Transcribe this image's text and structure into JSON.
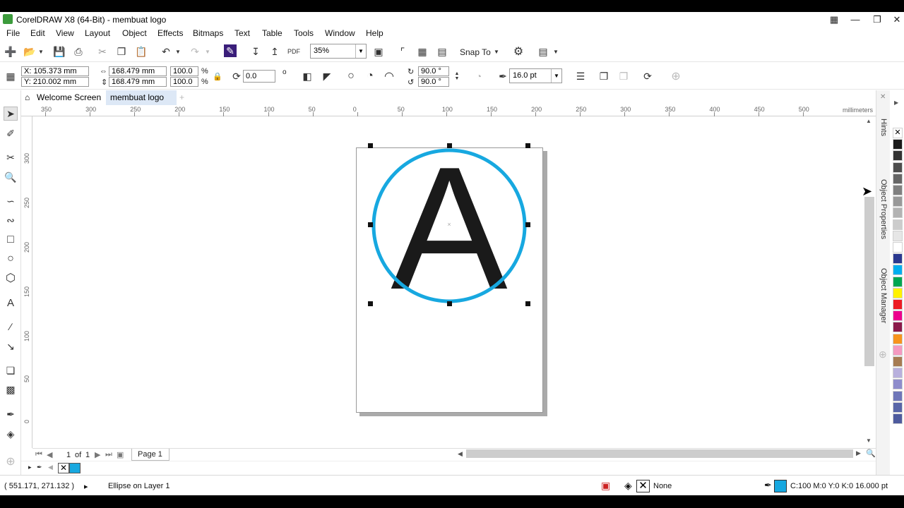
{
  "window": {
    "title": "CorelDRAW X8 (64-Bit) - membuat logo"
  },
  "menu": [
    "File",
    "Edit",
    "View",
    "Layout",
    "Object",
    "Effects",
    "Bitmaps",
    "Text",
    "Table",
    "Tools",
    "Window",
    "Help"
  ],
  "toolbar": {
    "zoom": "35%",
    "snap_label": "Snap To"
  },
  "property_bar": {
    "x": "X: 105.373 mm",
    "y": "Y: 210.002 mm",
    "width": "168.479 mm",
    "height": "168.479 mm",
    "scale_x": "100.0",
    "scale_y": "100.0",
    "pct": "%",
    "rotation": "0.0",
    "deg": "o",
    "angle_start": "90.0 °",
    "angle_end": "90.0 °",
    "outline": "16.0 pt"
  },
  "tabs": {
    "welcome": "Welcome Screen",
    "doc": "membuat logo",
    "add": "+"
  },
  "ruler": {
    "h_labels": [
      "350",
      "300",
      "250",
      "200",
      "150",
      "100",
      "50",
      "0",
      "50",
      "100",
      "150",
      "200",
      "250",
      "300",
      "350",
      "400",
      "450",
      "500"
    ],
    "unit": "millimeters",
    "v_labels": [
      "300",
      "250",
      "200",
      "150",
      "100",
      "50",
      "0"
    ]
  },
  "artwork": {
    "letter": "A",
    "circle_color": "#17a8e0",
    "letter_color": "#1a1a1a"
  },
  "docker_tabs": [
    "Hints",
    "Object Properties",
    "Object Manager"
  ],
  "palette": [
    "#ffffff",
    "#1a1a1a",
    "#333333",
    "#4d4d4d",
    "#666666",
    "#808080",
    "#999999",
    "#b3b3b3",
    "#cccccc",
    "#e6e6e6",
    "#ffffff",
    "#2b3990",
    "#00aeef",
    "#00a651",
    "#fff200",
    "#ed1c24",
    "#ec008c",
    "#8b1a4a",
    "#f7941d",
    "#f49ac1",
    "#a67c52",
    "#b8b0dd",
    "#8e8ccc",
    "#6f76b9",
    "#5865a8",
    "#4e5b9e"
  ],
  "page_nav": {
    "current": "1",
    "of_label": "of",
    "total": "1",
    "page_tab": "Page 1"
  },
  "status": {
    "coords": "( 551.171, 271.132 )",
    "arrow": "▸",
    "object": "Ellipse on Layer 1",
    "fill": "None",
    "outline_info": "C:100 M:0 Y:0 K:0  16.000 pt",
    "outline_color": "#17a8e0"
  }
}
